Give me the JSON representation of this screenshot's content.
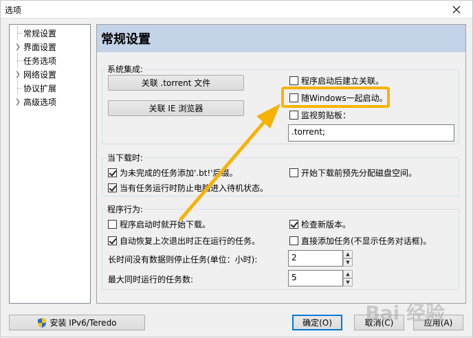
{
  "window": {
    "title": "选项"
  },
  "sidebar": {
    "items": [
      {
        "label": "常规设置",
        "expandable": false
      },
      {
        "label": "界面设置",
        "expandable": true
      },
      {
        "label": "任务选项",
        "expandable": false
      },
      {
        "label": "网络设置",
        "expandable": true
      },
      {
        "label": "协议扩展",
        "expandable": false
      },
      {
        "label": "高级选项",
        "expandable": true
      }
    ]
  },
  "panel": {
    "title": "常规设置",
    "system_integration": {
      "label": "系统集成:",
      "associate_torrent_button": "关联 .torrent 文件",
      "associate_ie_button": "关联 IE 浏览器",
      "create_association_on_start": {
        "label": "程序启动后建立关联。",
        "checked": false
      },
      "start_with_windows": {
        "label": "随Windows一起启动。",
        "checked": false
      },
      "monitor_clipboard": {
        "label": "监视剪贴板：",
        "checked": false
      },
      "clipboard_extensions_value": ".torrent;"
    },
    "during_download": {
      "label": "当下载时:",
      "add_bt_suffix": {
        "label": "为未完成的任务添加'.bt!'后缀。",
        "checked": true
      },
      "prevent_standby": {
        "label": "当有任务运行时防止电脑进入待机状态。",
        "checked": true
      },
      "preallocate_disk": {
        "label": "开始下载前预先分配磁盘空间。",
        "checked": false
      }
    },
    "program_behavior": {
      "label": "程序行为:",
      "start_download_on_launch": {
        "label": "程序启动时就开始下载。",
        "checked": false
      },
      "auto_resume": {
        "label": "自动恢复上次退出时正在运行的任务。",
        "checked": true
      },
      "check_new_version": {
        "label": "检查新版本。",
        "checked": true
      },
      "add_task_directly": {
        "label": "直接添加任务(不显示任务对话框)。",
        "checked": false
      },
      "stall_stop_label": "长时间没有数据则停止任务(单位：小时):",
      "stall_stop_value": "2",
      "max_tasks_label": "最大同时运行的任务数:",
      "max_tasks_value": "5"
    }
  },
  "footer": {
    "install_ipv6_button": "安装 IPv6/Teredo",
    "ok_button": "确定(O)",
    "cancel_button": "取消(C)",
    "apply_button": "应用(A)"
  },
  "annotation": {
    "accent_color": "#f7b300"
  },
  "watermark": "Bai 经验"
}
